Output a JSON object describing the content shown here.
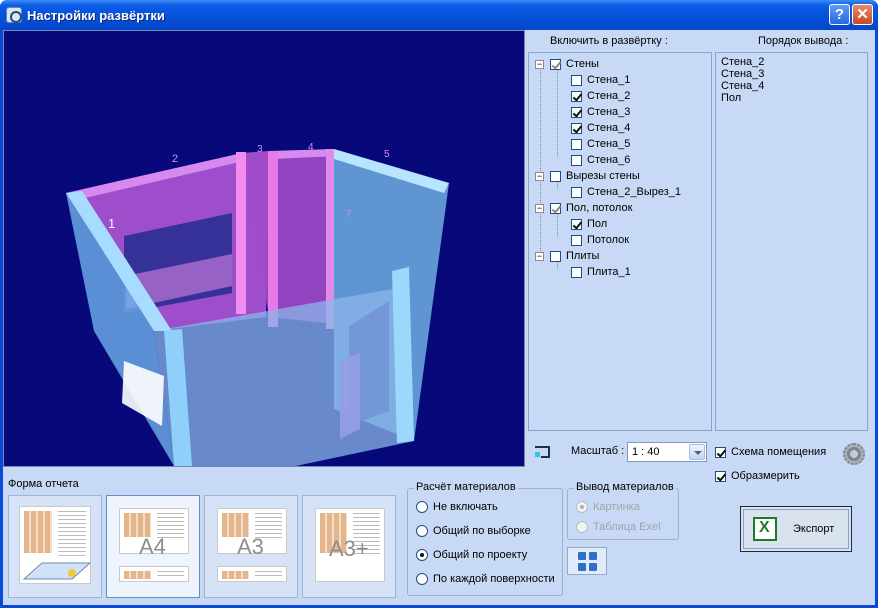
{
  "window": {
    "title": "Настройки развёртки",
    "help": "?",
    "close": "✕"
  },
  "viewport": {
    "wall_labels": [
      "1",
      "2",
      "3",
      "4",
      "5",
      "7"
    ]
  },
  "tree": {
    "label": "Включить в развёртку :",
    "nodes": [
      {
        "label": "Стены",
        "expander": "−",
        "checked": "grey"
      },
      {
        "label": "Стена_1",
        "checked": "off"
      },
      {
        "label": "Стена_2",
        "checked": "on"
      },
      {
        "label": "Стена_3",
        "checked": "on"
      },
      {
        "label": "Стена_4",
        "checked": "on"
      },
      {
        "label": "Стена_5",
        "checked": "off"
      },
      {
        "label": "Стена_6",
        "checked": "off"
      },
      {
        "label": "Вырезы стены",
        "expander": "−",
        "checked": "off"
      },
      {
        "label": "Стена_2_Вырез_1",
        "checked": "off"
      },
      {
        "label": "Пол, потолок",
        "expander": "−",
        "checked": "grey"
      },
      {
        "label": "Пол",
        "checked": "on"
      },
      {
        "label": "Потолок",
        "checked": "off"
      },
      {
        "label": "Плиты",
        "expander": "−",
        "checked": "off"
      },
      {
        "label": "Плита_1",
        "checked": "off"
      }
    ]
  },
  "order": {
    "label": "Порядок вывода :",
    "items": [
      "Стена_2",
      "Стена_3",
      "Стена_4",
      "Пол"
    ]
  },
  "scale": {
    "label": "Масштаб :",
    "value": "1 : 40"
  },
  "options": {
    "room_scheme": "Схема помещения",
    "room_scheme_checked": true,
    "dimension": "Образмерить",
    "dimension_checked": true
  },
  "report_form": {
    "label": "Форма отчета",
    "buttons": [
      "",
      "A4",
      "A3",
      "A3+"
    ]
  },
  "materials_calc": {
    "label": "Расчёт материалов",
    "options": [
      "Не включать",
      "Общий по выборке",
      "Общий по проекту",
      "По каждой поверхности"
    ],
    "selected": "Общий по проекту"
  },
  "materials_output": {
    "label": "Вывод материалов",
    "options": [
      "Картинка",
      "Таблица Exel"
    ],
    "selected": "Картинка"
  },
  "export": {
    "label": "Экспорт"
  },
  "colors": {
    "viewport_bg": "#07087a",
    "panel_bg": "#c7d9f5",
    "titlebar": "#0650d9"
  }
}
